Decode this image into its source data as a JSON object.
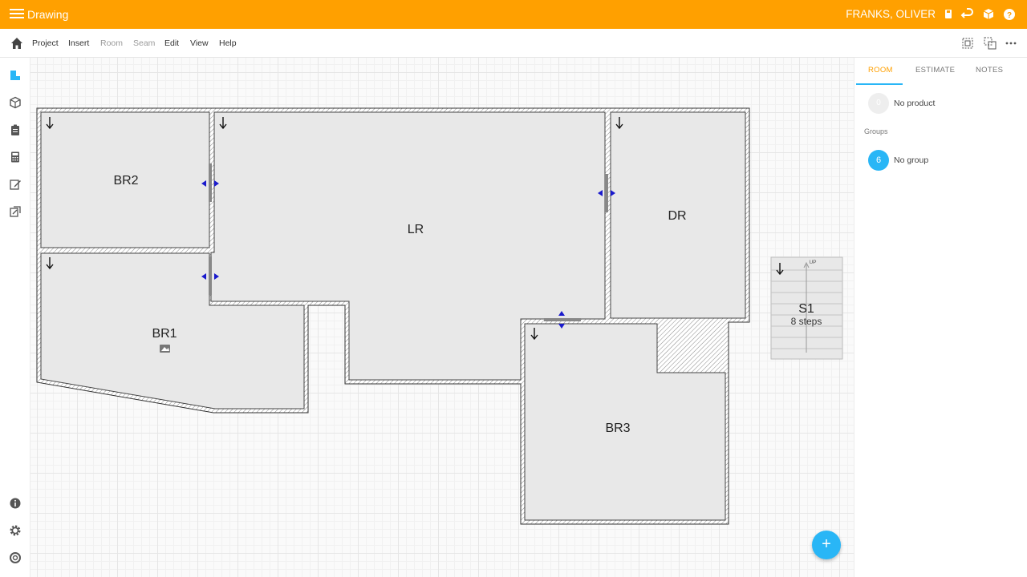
{
  "app": {
    "title": "Drawing",
    "user": "FRANKS, OLIVER"
  },
  "menu": {
    "items": [
      "Project",
      "Insert",
      "Room",
      "Seam",
      "Edit",
      "View",
      "Help"
    ]
  },
  "rooms": {
    "br2": "BR2",
    "lr": "LR",
    "dr": "DR",
    "br1": "BR1",
    "br3": "BR3",
    "s1": "S1",
    "s1_steps": "8 steps",
    "s1_up": "UP"
  },
  "panel": {
    "tabs": [
      "ROOM",
      "ESTIMATE",
      "NOTES"
    ],
    "product_badge": "0",
    "product_text": "No product",
    "groups_label": "Groups",
    "group_badge": "6",
    "group_text": "No group"
  },
  "fab_label": "+",
  "colors": {
    "accent": "#ffa000",
    "primary": "#29b6f6",
    "room_fill": "#e8e8e8",
    "connector": "#1a1acc"
  }
}
